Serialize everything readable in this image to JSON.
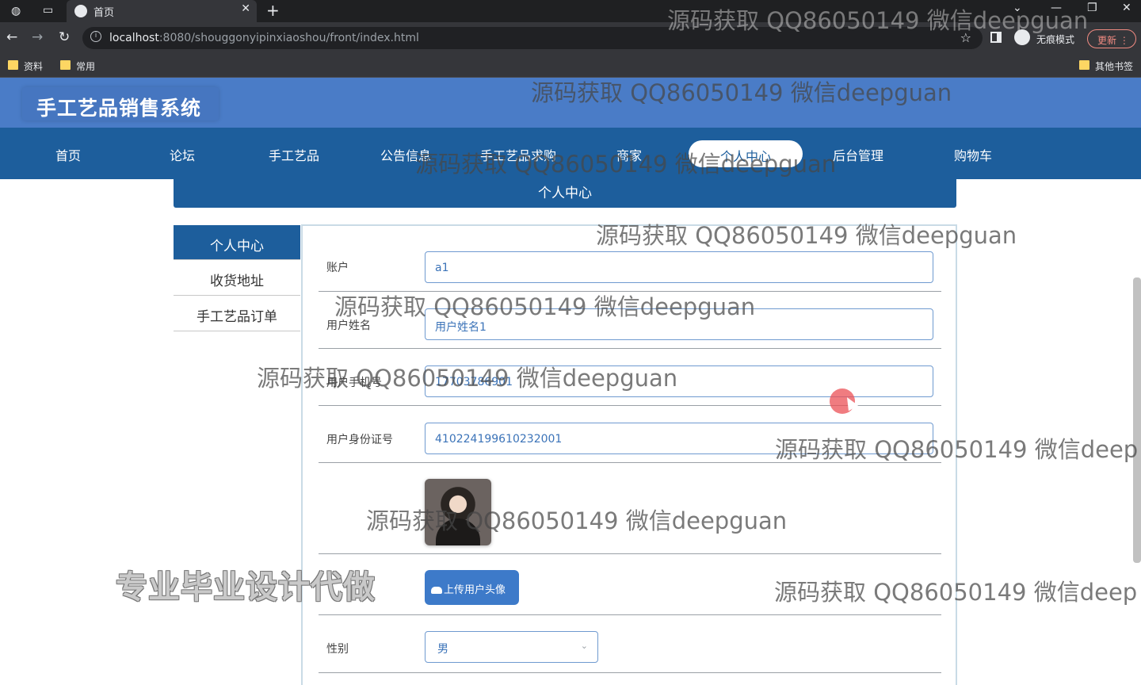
{
  "browser": {
    "tab_title": "首页",
    "new_tab_label": "+",
    "url_host": "localhost",
    "url_path": ":8080/shouggonyipinxiaoshou/front/index.html",
    "incognito_label": "无痕模式",
    "update_label": "更新",
    "bookmarks": [
      "资料",
      "常用"
    ],
    "other_bookmarks": "其他书签"
  },
  "site": {
    "title": "手工艺品销售系统"
  },
  "nav": {
    "items": [
      "首页",
      "论坛",
      "手工艺品",
      "公告信息",
      "手工艺品求购",
      "商家",
      "个人中心",
      "后台管理",
      "购物车"
    ],
    "active": "个人中心"
  },
  "panel": {
    "title": "个人中心"
  },
  "sidebar": {
    "items": [
      "个人中心",
      "收货地址",
      "手工艺品订单"
    ]
  },
  "form": {
    "account": {
      "label": "账户",
      "value": "a1"
    },
    "name": {
      "label": "用户姓名",
      "value": "用户姓名1"
    },
    "phone": {
      "label": "用户手机号",
      "value": "17703786901"
    },
    "idcard": {
      "label": "用户身份证号",
      "value": "410224199610232001"
    },
    "upload_label": "上传用户头像",
    "gender": {
      "label": "性别",
      "value": "男"
    }
  },
  "overlay": {
    "watermark": "源码获取 QQ86050149 微信deepguan",
    "watermark_cut": "源码获取 QQ86050149 微信deep",
    "promo": "专业毕业设计代做"
  },
  "colors": {
    "header": "#4a7cc7",
    "nav": "#1d5e9c",
    "accent": "#3d7ac9"
  }
}
